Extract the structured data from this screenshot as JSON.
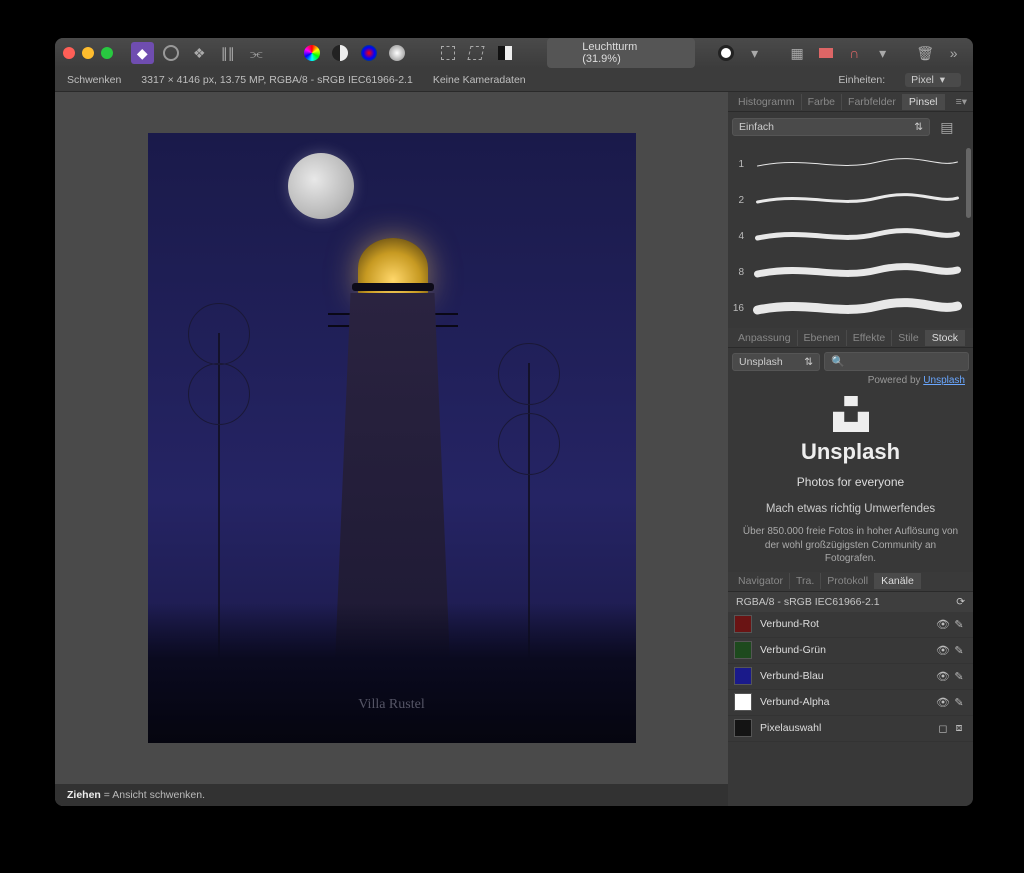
{
  "document": {
    "title": "Leuchtturm (31.9%)"
  },
  "infobar": {
    "tool": "Schwenken",
    "dims": "3317 × 4146 px, 13.75 MP, RGBA/8 - sRGB IEC61966-2.1",
    "camera": "Keine Kameradaten",
    "units_label": "Einheiten:",
    "units_value": "Pixel"
  },
  "panels": {
    "top_tabs": [
      "Histogramm",
      "Farbe",
      "Farbfelder",
      "Pinsel"
    ],
    "top_active": "Pinsel",
    "brush_category": "Einfach",
    "brush_sizes": [
      1,
      2,
      4,
      8,
      16
    ],
    "mid_tabs": [
      "Anpassung",
      "Ebenen",
      "Effekte",
      "Stile",
      "Stock"
    ],
    "mid_active": "Stock",
    "stock": {
      "source": "Unsplash",
      "powered_prefix": "Powered by ",
      "powered_link": "Unsplash",
      "brand": "Unsplash",
      "tagline": "Photos for everyone",
      "headline": "Mach etwas richtig Umwerfendes",
      "desc": "Über 850.000 freie Fotos in hoher Auflösung von der wohl großzügigsten Community an Fotografen."
    },
    "bottom_tabs": [
      "Navigator",
      "Tra.",
      "Protokoll",
      "Kanäle"
    ],
    "bottom_active": "Kanäle",
    "channels": {
      "header": "RGBA/8 - sRGB IEC61966-2.1",
      "items": [
        {
          "name": "Verbund-Rot",
          "color": "#6a1414",
          "eye": true,
          "edit": true
        },
        {
          "name": "Verbund-Grün",
          "color": "#1e4a1e",
          "eye": true,
          "edit": true
        },
        {
          "name": "Verbund-Blau",
          "color": "#1a1a8a",
          "eye": true,
          "edit": true
        },
        {
          "name": "Verbund-Alpha",
          "color": "#ffffff",
          "eye": true,
          "edit": true
        },
        {
          "name": "Pixelauswahl",
          "color": "#141414",
          "eye": false,
          "edit": false
        }
      ]
    }
  },
  "status": {
    "key": "Ziehen",
    "text": " = Ansicht schwenken."
  },
  "artwork": {
    "signature": "Villa Rustel"
  }
}
